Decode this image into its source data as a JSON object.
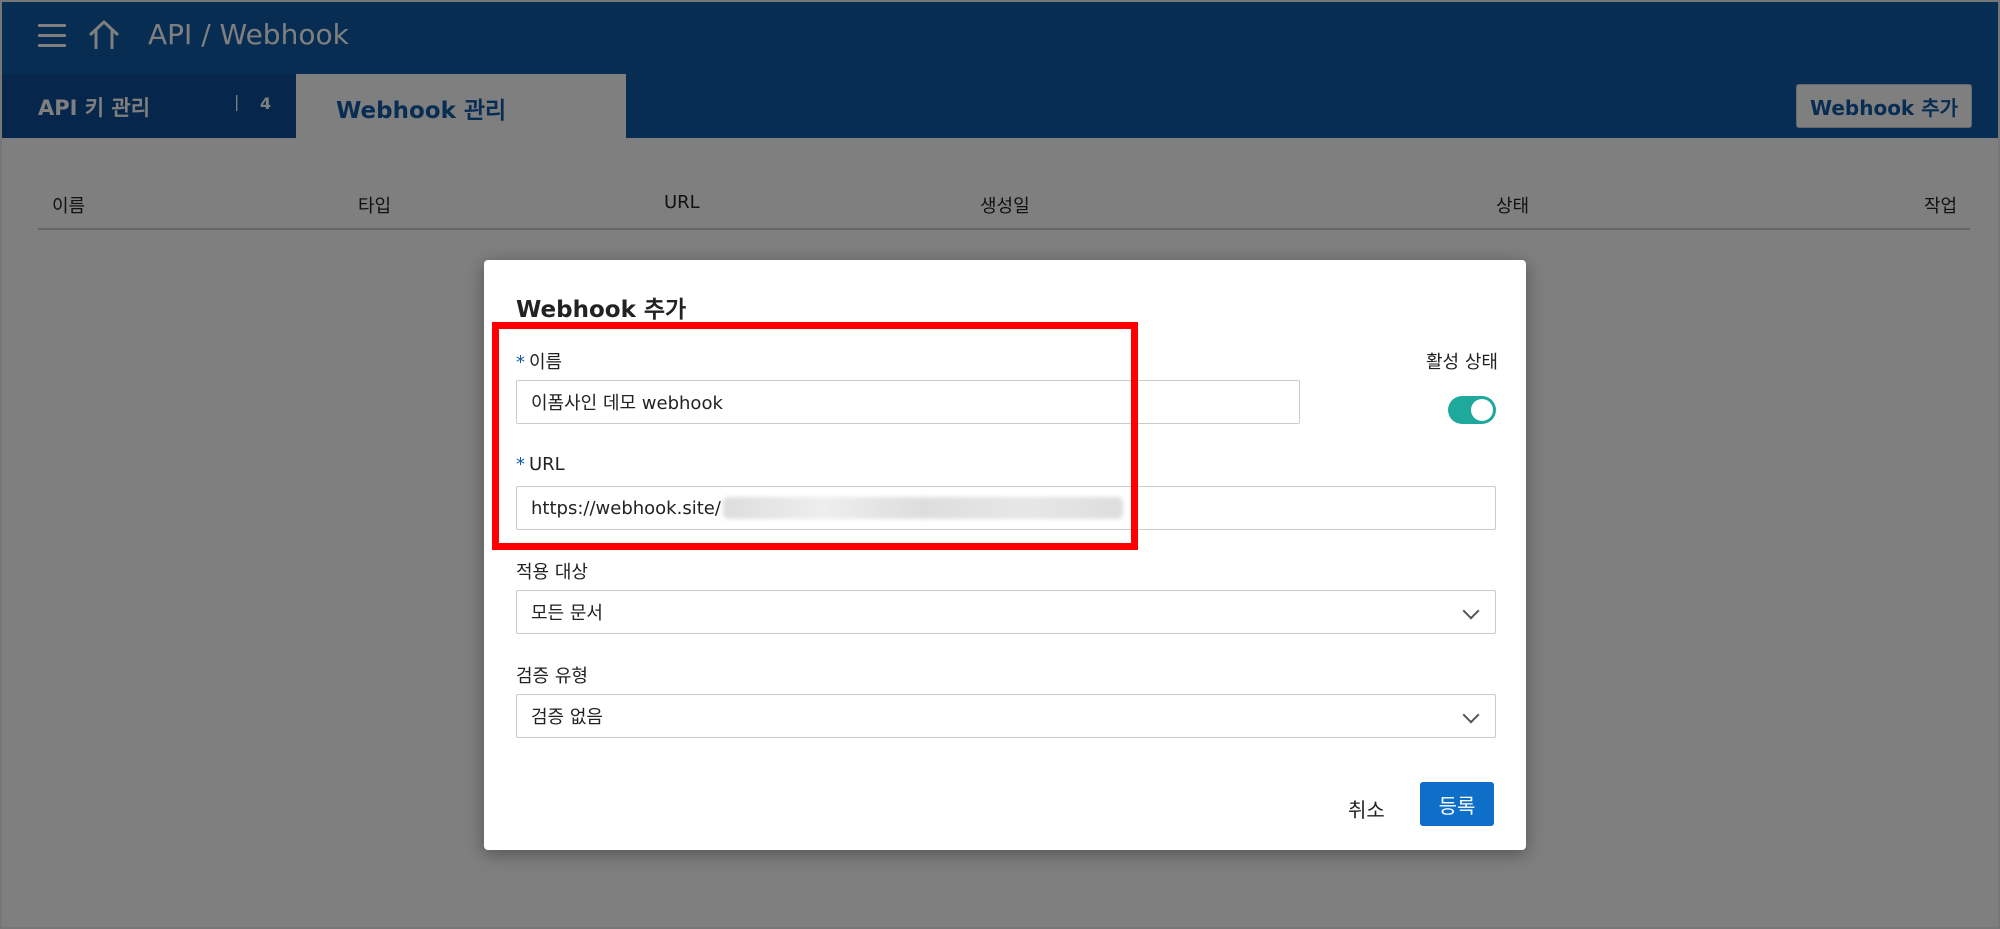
{
  "header": {
    "title": "API / Webhook",
    "menu_icon": "hamburger-menu-icon",
    "home_icon": "home-icon"
  },
  "tabs": {
    "api_keys": {
      "label": "API 키 관리",
      "separator": "|",
      "count": "4"
    },
    "webhook": {
      "label": "Webhook 관리"
    }
  },
  "toolbar": {
    "add_webhook_label": "Webhook 추가"
  },
  "table": {
    "columns": [
      "이름",
      "타입",
      "URL",
      "생성일",
      "상태",
      "작업"
    ]
  },
  "modal": {
    "title": "Webhook 추가",
    "name": {
      "required_mark": "*",
      "label": "이름",
      "value": "이폼사인 데모 webhook"
    },
    "active": {
      "label": "활성 상태",
      "on": true
    },
    "url": {
      "required_mark": "*",
      "label": "URL",
      "value": "https://webhook.site/"
    },
    "target": {
      "label": "적용 대상",
      "value": "모든 문서"
    },
    "verification": {
      "label": "검증 유형",
      "value": "검증 없음"
    },
    "cancel_label": "취소",
    "submit_label": "등록"
  },
  "colors": {
    "primary": "#0e5aa7",
    "toggle_on": "#1fa99c",
    "submit": "#0e6fc8",
    "highlight": "#ff0000"
  }
}
